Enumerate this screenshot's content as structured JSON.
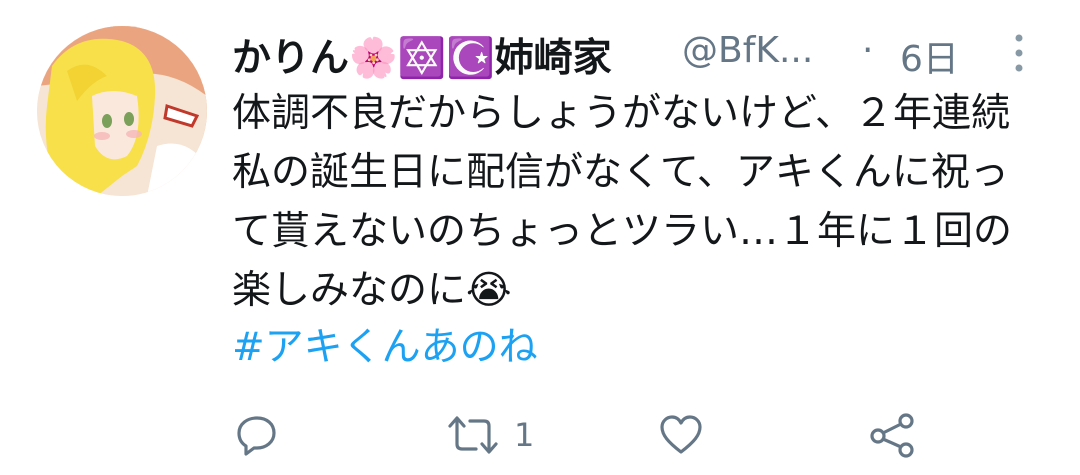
{
  "tweet": {
    "display_name": "かりん🌸🔯☪️姉崎家",
    "handle": "@BfK...",
    "separator": "·",
    "time": "6日",
    "text": "体調不良だからしょうがないけど、２年連続私の誕生日に配信がなくて、アキくんに祝って貰えないのちょっとツラい…１年に１回の楽しみなのに😭",
    "hashtag": "#アキくんあのね"
  },
  "actions": {
    "reply_count": "",
    "retweet_count": "1",
    "like_count": ""
  },
  "icons": {
    "more": "more-vertical-icon",
    "reply": "reply-icon",
    "retweet": "retweet-icon",
    "like": "heart-icon",
    "share": "share-icon"
  },
  "colors": {
    "text": "#14171a",
    "secondary": "#657786",
    "link": "#1da1f2"
  }
}
